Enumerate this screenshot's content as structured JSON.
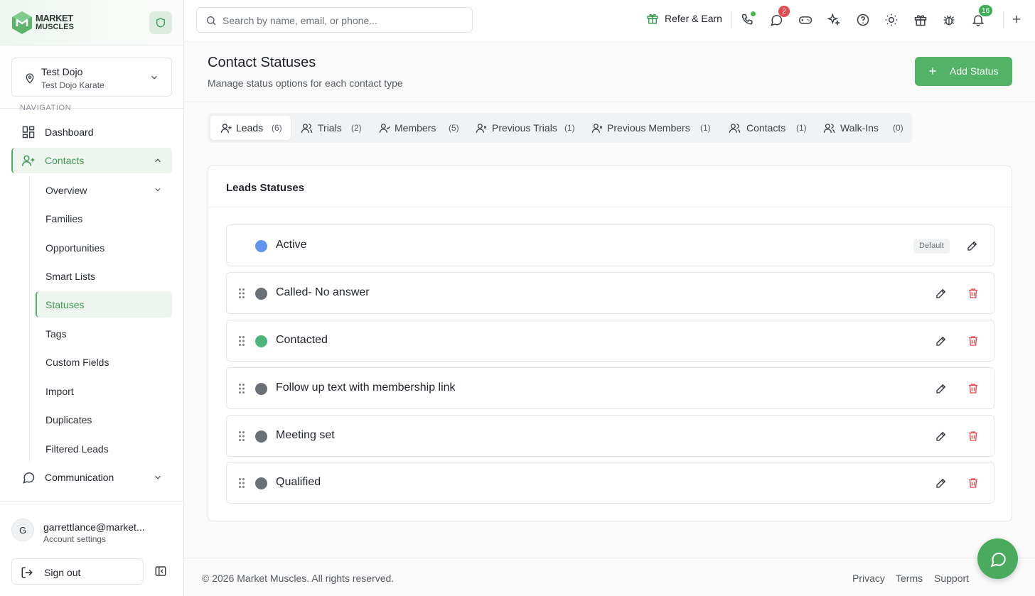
{
  "brand": {
    "logo_line1": "MARKET",
    "logo_line2": "MUSCLES",
    "accent": "#52b266"
  },
  "location": {
    "name": "Test Dojo",
    "subtitle": "Test Dojo Karate"
  },
  "nav": {
    "section_label": "NAVIGATION",
    "items": [
      {
        "label": "Dashboard",
        "icon": "dashboard-icon"
      },
      {
        "label": "Contacts",
        "icon": "user-plus-icon",
        "expanded": true
      },
      {
        "label": "Communication",
        "icon": "chat-icon"
      }
    ],
    "contacts_sub": [
      {
        "label": "Overview"
      },
      {
        "label": "Families"
      },
      {
        "label": "Opportunities"
      },
      {
        "label": "Smart Lists"
      },
      {
        "label": "Statuses",
        "active": true
      },
      {
        "label": "Tags"
      },
      {
        "label": "Custom Fields"
      },
      {
        "label": "Import"
      },
      {
        "label": "Duplicates"
      },
      {
        "label": "Filtered Leads"
      }
    ]
  },
  "account": {
    "initial": "G",
    "email": "garrettlance@market...",
    "sub": "Account settings",
    "signout": "Sign out"
  },
  "topbar": {
    "search_placeholder": "Search by name, email, or phone...",
    "refer": "Refer & Earn",
    "messages_badge": "2",
    "notifications_badge": "16"
  },
  "page": {
    "title": "Contact Statuses",
    "subtitle": "Manage status options for each contact type",
    "add_button": "Add Status"
  },
  "tabs": [
    {
      "label": "Leads",
      "count": "(6)",
      "active": true
    },
    {
      "label": "Trials",
      "count": "(2)"
    },
    {
      "label": "Members",
      "count": "(5)"
    },
    {
      "label": "Previous Trials",
      "count": "(1)"
    },
    {
      "label": "Previous Members",
      "count": "(1)"
    },
    {
      "label": "Contacts",
      "count": "(1)"
    },
    {
      "label": "Walk-Ins",
      "count": "(0)"
    }
  ],
  "card": {
    "title": "Leads Statuses",
    "default_label": "Default",
    "statuses": [
      {
        "name": "Active",
        "color": "#6295ef",
        "default": true
      },
      {
        "name": "Called- No answer",
        "color": "#6b7078"
      },
      {
        "name": "Contacted",
        "color": "#4cb579"
      },
      {
        "name": "Follow up text with membership link",
        "color": "#6b7078"
      },
      {
        "name": "Meeting set",
        "color": "#6b7078"
      },
      {
        "name": "Qualified",
        "color": "#6b7078"
      }
    ]
  },
  "footer": {
    "copyright": "© 2026 Market Muscles. All rights reserved.",
    "privacy": "Privacy",
    "terms": "Terms",
    "support": "Support"
  }
}
